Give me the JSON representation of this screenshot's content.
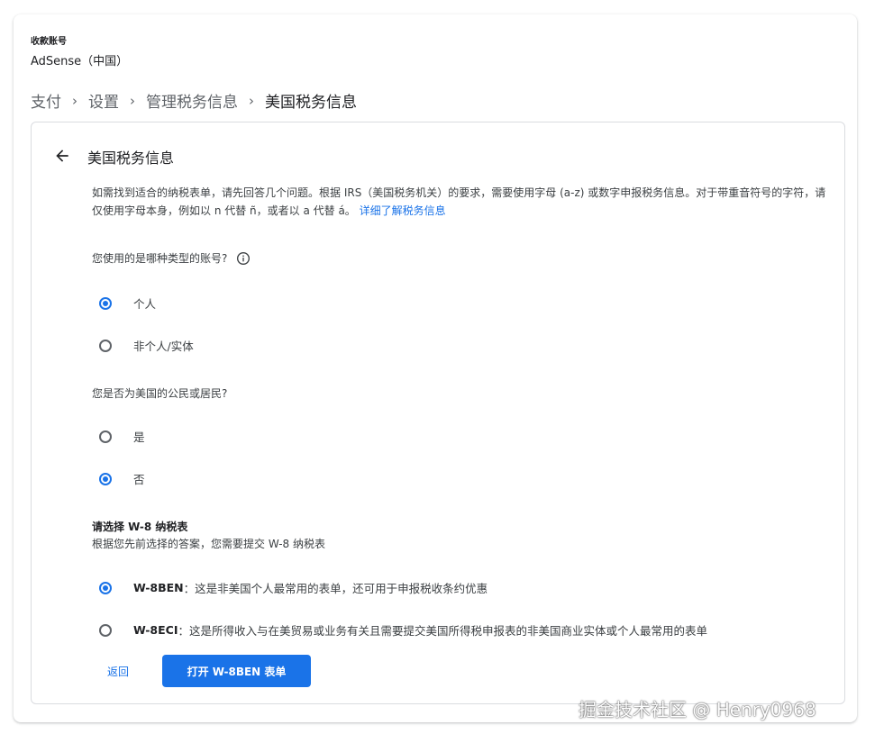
{
  "account": {
    "label": "收款账号",
    "value": "AdSense（中国）"
  },
  "breadcrumb": {
    "items": [
      "支付",
      "设置",
      "管理税务信息",
      "美国税务信息"
    ]
  },
  "section": {
    "title": "美国税务信息",
    "intro": "如需找到适合的纳税表单，请先回答几个问题。根据 IRS（美国税务机关）的要求，需要使用字母 (a-z) 或数字申报税务信息。对于带重音符号的字符，请仅使用字母本身，例如以 n 代替 ñ，或者以 a 代替 á。",
    "learn_more_link": "详细了解税务信息"
  },
  "q1": {
    "text": "您使用的是哪种类型的账号?",
    "options": [
      {
        "label": "个人",
        "checked": true
      },
      {
        "label": "非个人/实体",
        "checked": false
      }
    ]
  },
  "q2": {
    "text": "您是否为美国的公民或居民?",
    "options": [
      {
        "label": "是",
        "checked": false
      },
      {
        "label": "否",
        "checked": true
      }
    ]
  },
  "w8": {
    "title": "请选择 W-8 纳税表",
    "subtitle": "根据您先前选择的答案，您需要提交 W-8 纳税表",
    "options": [
      {
        "name": "W-8BEN",
        "desc": "：这是非美国个人最常用的表单，还可用于申报税收条约优惠",
        "checked": true
      },
      {
        "name": "W-8ECI",
        "desc": "：这是所得收入与在美贸易或业务有关且需要提交美国所得税申报表的非美国商业实体或个人最常用的表单",
        "checked": false
      }
    ]
  },
  "actions": {
    "back_label": "返回",
    "open_label": "打开 W-8BEN 表单"
  },
  "watermark": "掘金技术社区 @ Henry0968",
  "colors": {
    "accent": "#1a73e8",
    "text": "#202124",
    "muted": "#5f6368",
    "border": "#dadce0"
  },
  "icons": {
    "back": "arrow-back-icon",
    "info": "info-icon",
    "separator": "chevron-right-icon"
  }
}
